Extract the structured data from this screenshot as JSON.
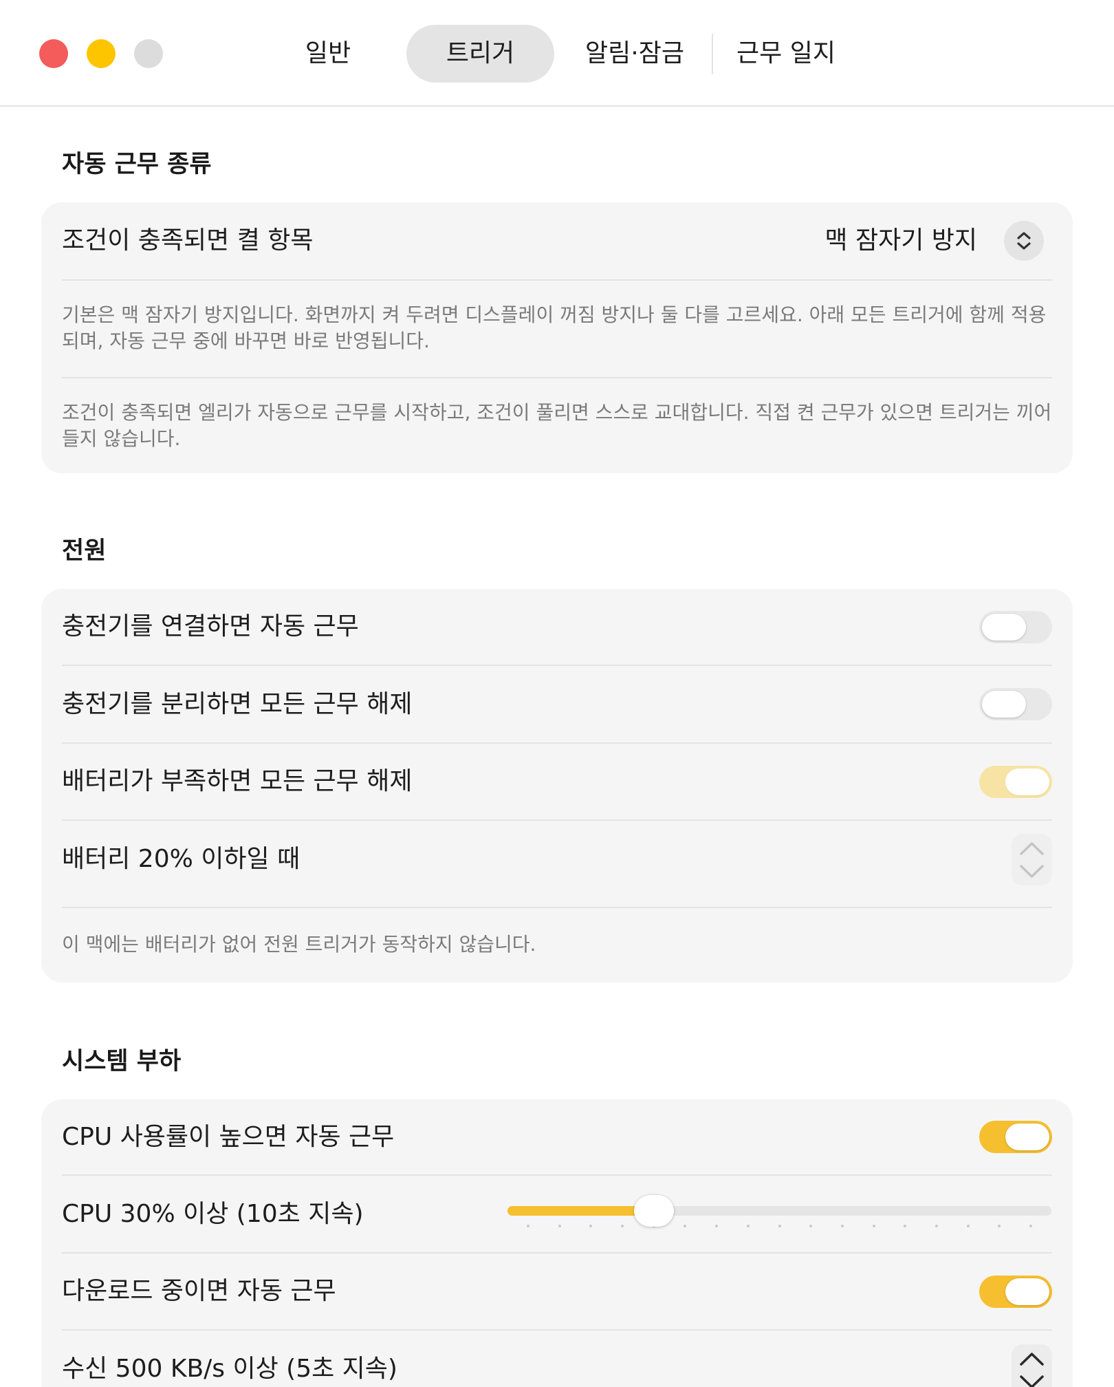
{
  "colors": {
    "accent": "#f6bf2f",
    "accent_disabled": "#f7e4a4",
    "close_button": "#f45b5b",
    "minimize_button": "#fdc500",
    "zoom_button": "#dcdcdc",
    "card_background": "#f5f5f5",
    "secondary_text": "#7a7a7a"
  },
  "tabs": [
    {
      "label": "일반",
      "selected": false
    },
    {
      "label": "트리거",
      "selected": true
    },
    {
      "label": "알림·잠금",
      "selected": false
    },
    {
      "label": "근무 일지",
      "selected": false
    }
  ],
  "auto_shift_type": {
    "heading": "자동 근무 종류",
    "label": "조건이 충족되면 켤 항목",
    "selected_value": "맥 잠자기 방지",
    "popup_icon": "up-down-chevron-icon",
    "help_text": "기본은 맥 잠자기 방지입니다. 화면까지 켜 두려면 디스플레이 꺼짐 방지나 둘 다를 고르세요. 아래 모든 트리거에 함께 적용되며, 자동 근무 중에 바꾸면 바로 반영됩니다.",
    "explanation": "조건이 충족되면 엘리가 자동으로 근무를 시작하고, 조건이 풀리면 스스로 교대합니다. 직접 켠 근무가 있으면 트리거는 끼어들지 않습니다."
  },
  "power": {
    "heading": "전원",
    "connect_charger": {
      "label": "충전기를 연결하면 자동 근무",
      "on": false,
      "disabled": false
    },
    "disconnect_charger": {
      "label": "충전기를 분리하면 모든 근무 해제",
      "on": false,
      "disabled": false
    },
    "low_battery": {
      "label": "배터리가 부족하면 모든 근무 해제",
      "on": true,
      "disabled": true
    },
    "battery_threshold": {
      "label": "배터리 20% 이하일 때",
      "disabled": true
    },
    "note": "이 맥에는 배터리가 없어 전원 트리거가 동작하지 않습니다."
  },
  "system_load": {
    "heading": "시스템 부하",
    "cpu_trigger": {
      "label": "CPU 사용률이 높으면 자동 근무",
      "on": true,
      "disabled": false
    },
    "cpu_threshold": {
      "label": "CPU 30% 이상 (10초 지속)",
      "slider_level": 0.25
    },
    "download_trigger": {
      "label": "다운로드 중이면 자동 근무",
      "on": true,
      "disabled": false
    },
    "download_threshold": {
      "label": "수신 500 KB/s 이상 (5초 지속)",
      "disabled": false
    }
  }
}
